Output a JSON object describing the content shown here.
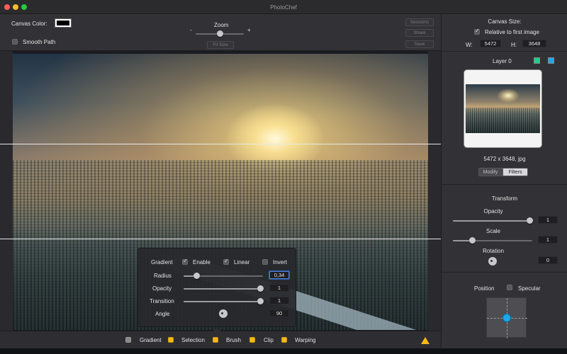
{
  "window": {
    "title": "PhotoChef"
  },
  "toolbar": {
    "canvas_color_label": "Canvas Color:",
    "smooth_path_label": "Smooth Path",
    "zoom_label": "Zoom",
    "zoom_minus": "-",
    "zoom_plus": "+",
    "zoom_level": 0.5,
    "fit_size_label": "Fit Size",
    "sessions_label": "Sessions",
    "share_label": "Share",
    "save_label": "Save"
  },
  "gradient_panel": {
    "gradient_label": "Gradient",
    "enable_label": "Enable",
    "linear_label": "Linear",
    "invert_label": "Invert",
    "radius_label": "Radius",
    "radius_value": "0,34",
    "opacity_label": "Opacity",
    "opacity_value": "1",
    "transition_label": "Transition",
    "transition_value": "1",
    "angle_label": "Angle",
    "angle_value": "90"
  },
  "bottom_bar": {
    "items": [
      "Gradient",
      "Selection",
      "Brush",
      "Clip",
      "Warping"
    ]
  },
  "right_panel": {
    "canvas_size_label": "Canvas Size:",
    "relative_label": "Relative to first image",
    "w_label": "W:",
    "w_value": "5472",
    "h_label": "H:",
    "h_value": "3648",
    "layer_label": "Layer 0",
    "image_info": "5472 x 3648, jpg",
    "modify_label": "Modify",
    "filters_label": "Filters",
    "transform_label": "Transform",
    "opacity_label": "Opacity",
    "opacity_value": "1",
    "scale_label": "Scale",
    "scale_value": "1",
    "rotation_label": "Rotation",
    "rotation_value": "0",
    "position_label": "Position",
    "specular_label": "Specular"
  },
  "colors": {
    "layer_green": "#19d08a",
    "layer_blue": "#1ea8ea",
    "accent_yellow": "#f5b81c"
  }
}
